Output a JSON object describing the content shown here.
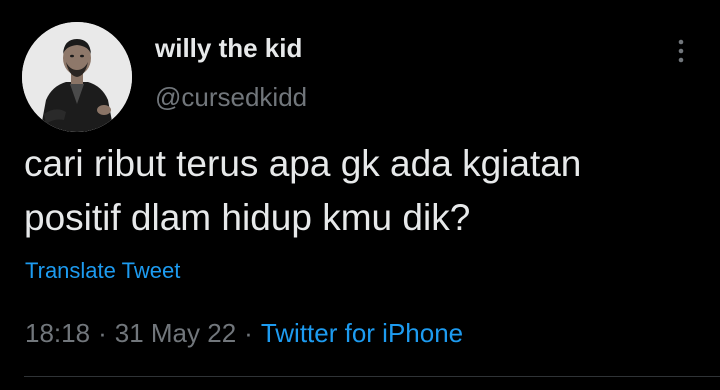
{
  "user": {
    "display_name": "willy the kid",
    "handle": "@cursedkidd"
  },
  "icons": {
    "avatar": "person-photo-avatar",
    "more": "more-vertical-icon"
  },
  "tweet": {
    "text_lines": [
      "cari ribut terus apa gk ada kgiatan",
      "positif dlam hidup kmu dik?"
    ],
    "translate_label": "Translate Tweet",
    "time": "18:18",
    "date": "31 May 22",
    "separator": "·",
    "source": "Twitter for iPhone"
  },
  "colors": {
    "background": "#000000",
    "primary_text": "#e7e9ea",
    "secondary_text": "#71767b",
    "accent": "#1d9bf0"
  }
}
